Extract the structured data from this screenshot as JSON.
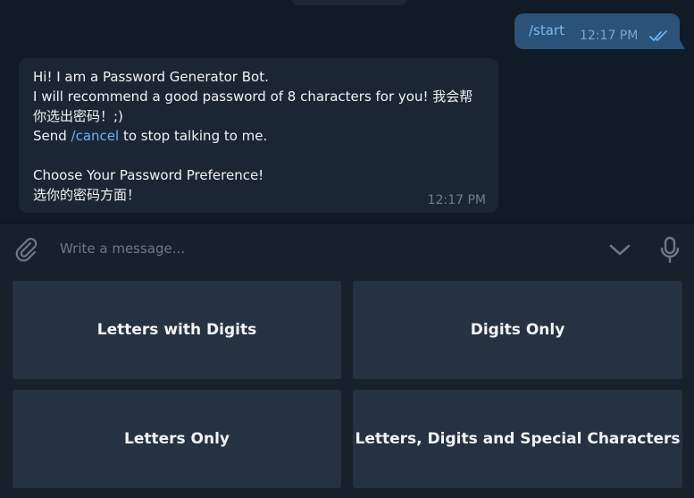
{
  "messages": {
    "outgoing": {
      "text": "/start",
      "time": "12:17 PM",
      "status": "read-double-check"
    },
    "incoming": {
      "line1": "Hi! I am a Password Generator Bot.",
      "line2": "I will recommend a good password of 8 characters for you! 我会帮你选出密码！;)",
      "line3_prefix": "Send ",
      "line3_command": "/cancel",
      "line3_suffix": " to stop talking to me.",
      "line4": "",
      "line5": "Choose Your Password Preference!",
      "line6": "选你的密码方面！",
      "time": "12:17 PM"
    }
  },
  "composer": {
    "placeholder": "Write a message...",
    "attach_icon": "paperclip-icon",
    "scroll_icon": "chevron-down-icon",
    "mic_icon": "microphone-icon"
  },
  "keyboard": {
    "buttons": [
      "Letters with Digits",
      "Digits Only",
      "Letters Only",
      "Letters, Digits and Special Characters"
    ]
  },
  "colors": {
    "chat_bg": "#111b26",
    "outgoing_bubble": "#2b5278",
    "incoming_bubble": "#1a2633",
    "link": "#6ab2f2",
    "button_bg": "#253242",
    "panel_bg": "#17212b"
  }
}
